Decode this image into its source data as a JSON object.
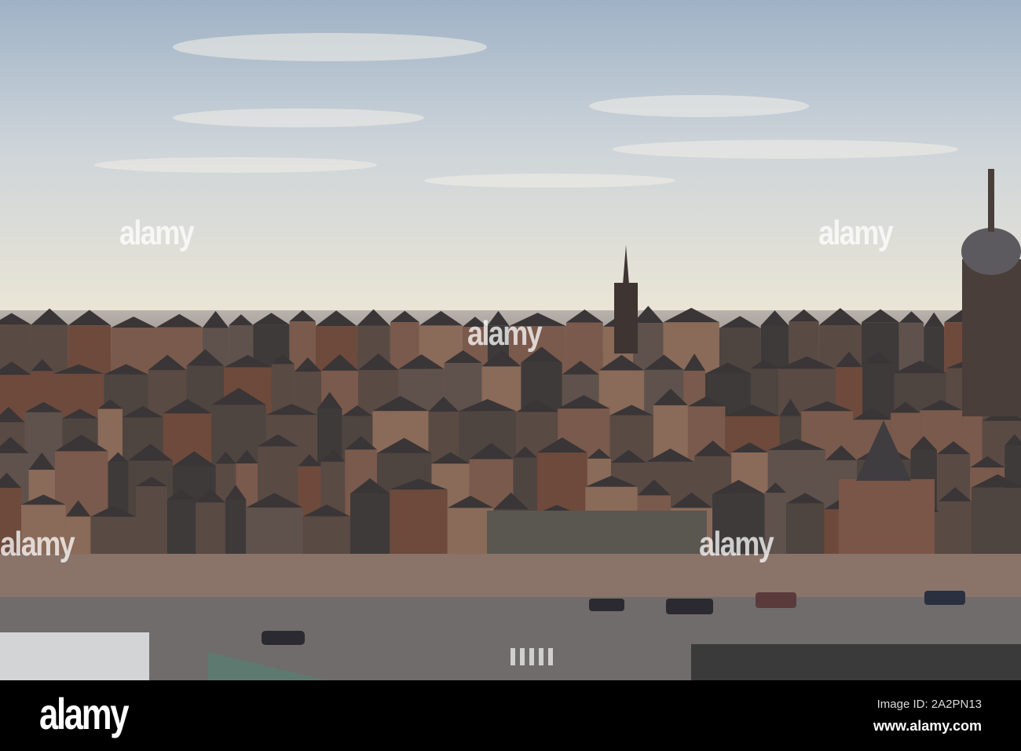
{
  "photo": {
    "subject": "Amsterdam skyline",
    "colors": {
      "sky_top": "#9fb2c6",
      "sky_mid": "#cdd4d9",
      "horizon": "#ece6d6",
      "roofs": "#5a4a44",
      "brick": "#6e4a3c",
      "road": "#6f6c6b",
      "pavement": "#8a7469"
    }
  },
  "watermark": {
    "text": "alamy"
  },
  "footer": {
    "logo": "alamy",
    "image_id": "Image ID: 2A2PN13",
    "url": "www.alamy.com"
  }
}
